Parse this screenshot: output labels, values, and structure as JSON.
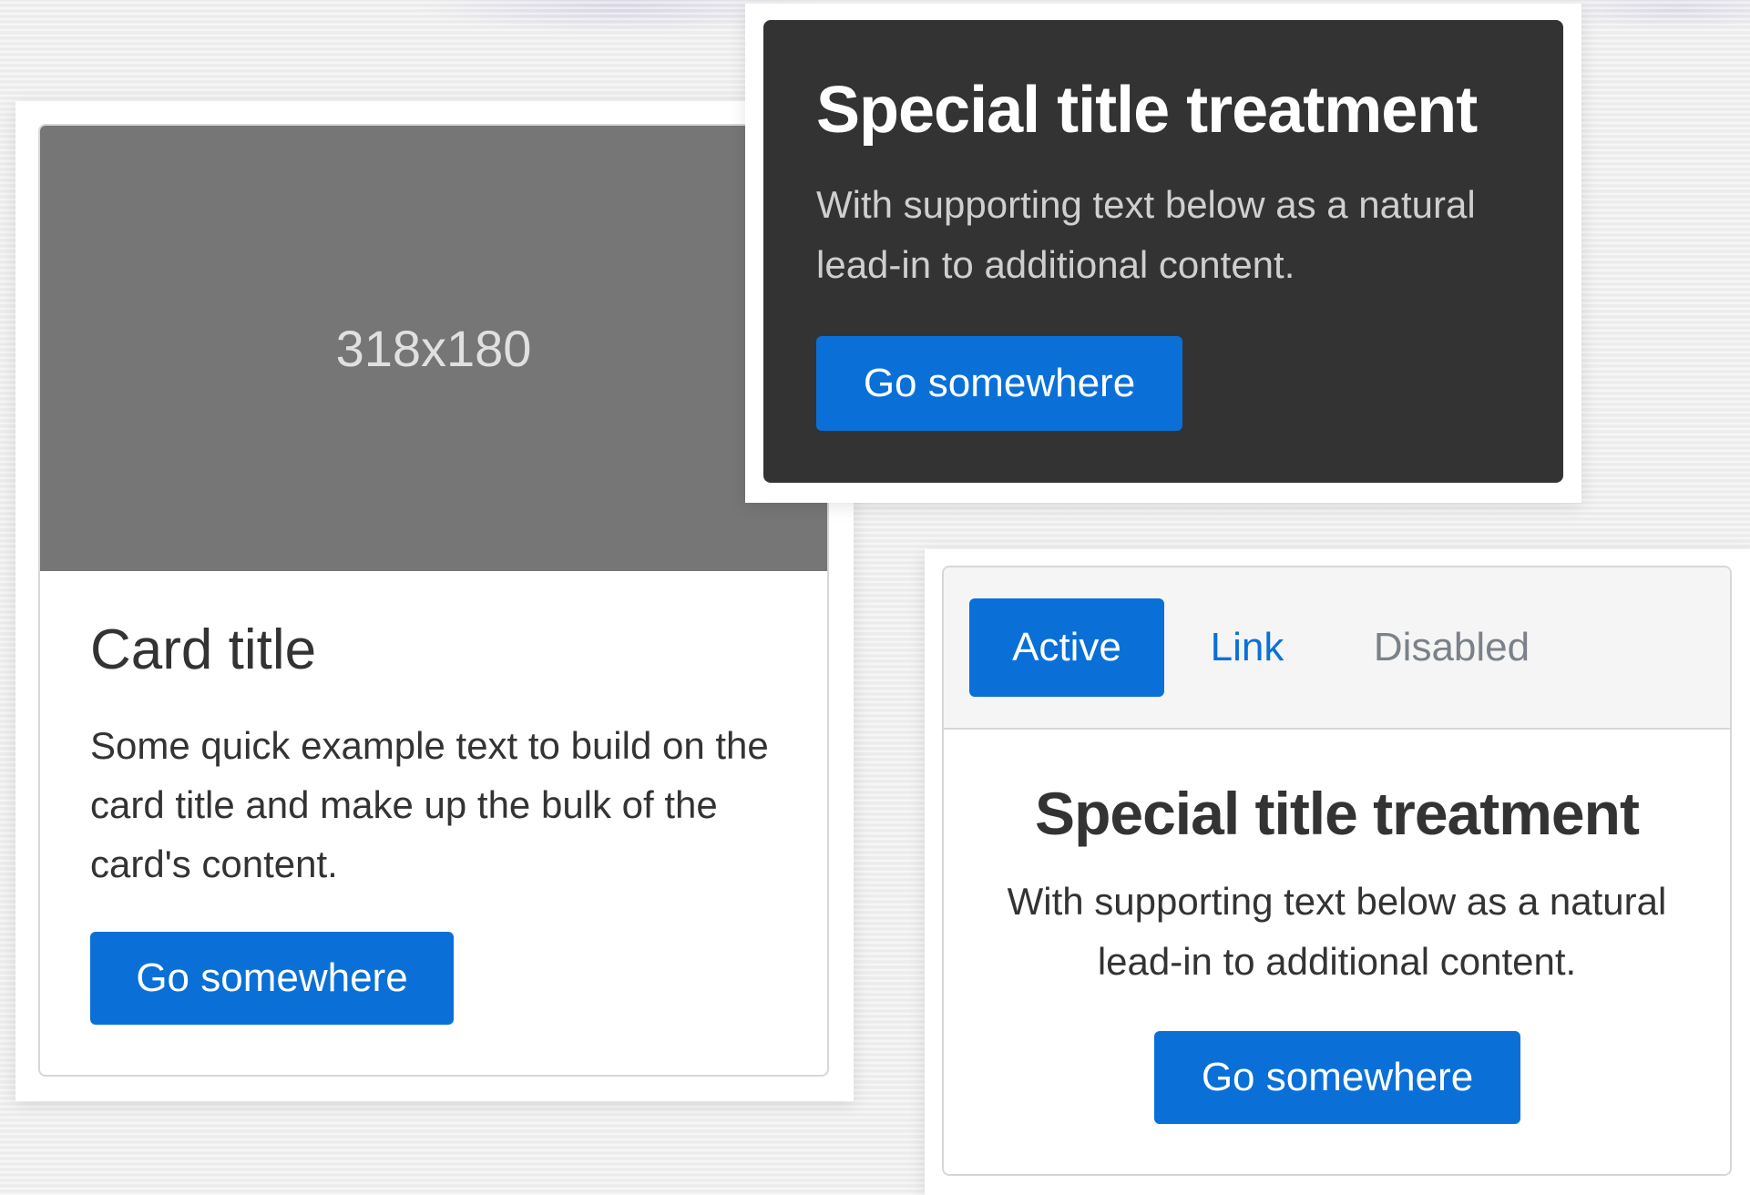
{
  "card_left": {
    "image_placeholder": "318x180",
    "title": "Card title",
    "text": "Some quick example text to build on the card title and make up the bulk of the card's content.",
    "button_label": "Go somewhere"
  },
  "card_dark": {
    "title": "Special title treatment",
    "text": "With supporting text below as a natural lead-in to additional content.",
    "button_label": "Go somewhere"
  },
  "card_nav": {
    "tabs": [
      {
        "label": "Active",
        "state": "active"
      },
      {
        "label": "Link",
        "state": "link"
      },
      {
        "label": "Disabled",
        "state": "disabled"
      }
    ],
    "title": "Special title treatment",
    "text": "With supporting text below as a natural lead-in to additional content.",
    "button_label": "Go somewhere"
  },
  "colors": {
    "primary": "#0a70d8",
    "dark_card": "#333333",
    "image_placeholder": "#767676",
    "disabled_text": "#7b8189"
  }
}
